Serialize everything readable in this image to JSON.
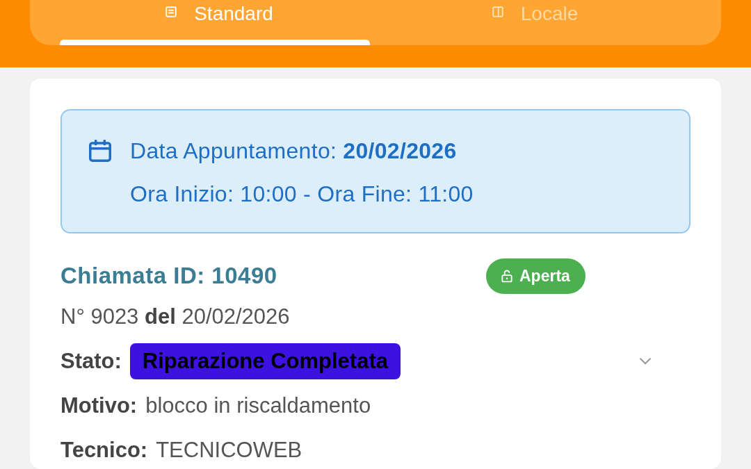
{
  "tabs": [
    {
      "label": "Standard",
      "selected": true
    },
    {
      "label": "Locale",
      "selected": false
    }
  ],
  "appointment": {
    "date_label": "Data Appuntamento:",
    "date": "20/02/2026",
    "time_line": "Ora Inizio: 10:00 - Ora Fine: 11:00"
  },
  "call": {
    "title": "Chiamata ID: 10490",
    "badge": {
      "label": "Aperta",
      "color": "#4caf50"
    },
    "fields": [
      {
        "kind": "text",
        "text": "N° 9023 **del** 20/02/2026"
      },
      {
        "kind": "status",
        "label": "Stato:",
        "value": "Riparazione Completata",
        "color": "#3d12e0",
        "expanded": false
      },
      {
        "kind": "field",
        "label": "Motivo:",
        "value": "blocco in riscaldamento"
      },
      {
        "kind": "field",
        "label": "Tecnico:",
        "value": "TECNICOWEB"
      }
    ]
  }
}
